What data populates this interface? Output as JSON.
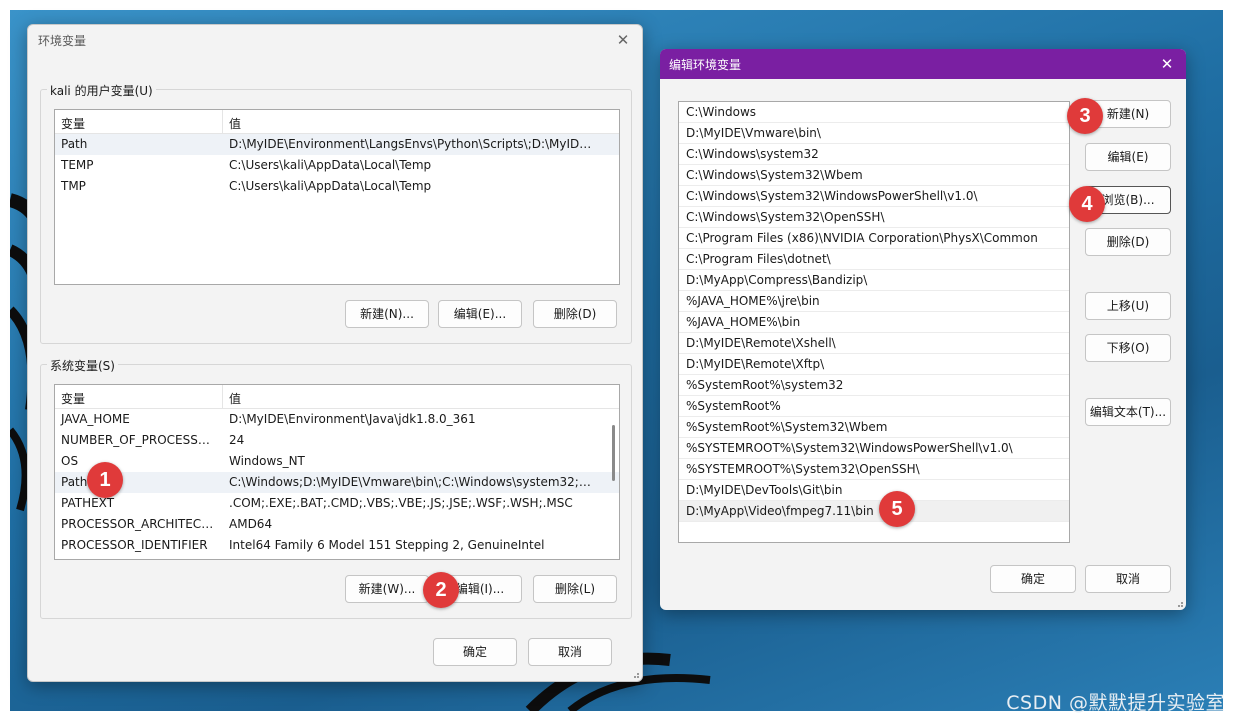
{
  "env_dialog": {
    "title": "环境变量",
    "user_group_title": "kali 的用户变量(U)",
    "user_columns": [
      "变量",
      "值"
    ],
    "user_rows": [
      {
        "name": "Path",
        "value": "D:\\MyIDE\\Environment\\LangsEnvs\\Python\\Scripts\\;D:\\MyIDE\\..."
      },
      {
        "name": "TEMP",
        "value": "C:\\Users\\kali\\AppData\\Local\\Temp"
      },
      {
        "name": "TMP",
        "value": "C:\\Users\\kali\\AppData\\Local\\Temp"
      }
    ],
    "user_buttons": {
      "new": "新建(N)...",
      "edit": "编辑(E)...",
      "delete": "删除(D)"
    },
    "system_group_title": "系统变量(S)",
    "system_columns": [
      "变量",
      "值"
    ],
    "system_rows": [
      {
        "name": "JAVA_HOME",
        "value": "D:\\MyIDE\\Environment\\Java\\jdk1.8.0_361"
      },
      {
        "name": "NUMBER_OF_PROCESSORS",
        "value": "24"
      },
      {
        "name": "OS",
        "value": "Windows_NT"
      },
      {
        "name": "Path",
        "value": "C:\\Windows;D:\\MyIDE\\Vmware\\bin\\;C:\\Windows\\system32;C:\\..."
      },
      {
        "name": "PATHEXT",
        "value": ".COM;.EXE;.BAT;.CMD;.VBS;.VBE;.JS;.JSE;.WSF;.WSH;.MSC"
      },
      {
        "name": "PROCESSOR_ARCHITECT...",
        "value": "AMD64"
      },
      {
        "name": "PROCESSOR_IDENTIFIER",
        "value": "Intel64 Family 6 Model 151 Stepping 2, GenuineIntel"
      }
    ],
    "system_buttons": {
      "new": "新建(W)...",
      "edit": "编辑(I)...",
      "delete": "删除(L)"
    },
    "ok": "确定",
    "cancel": "取消"
  },
  "edit_dialog": {
    "title": "编辑环境变量",
    "paths": [
      "C:\\Windows",
      "D:\\MyIDE\\Vmware\\bin\\",
      "C:\\Windows\\system32",
      "C:\\Windows\\System32\\Wbem",
      "C:\\Windows\\System32\\WindowsPowerShell\\v1.0\\",
      "C:\\Windows\\System32\\OpenSSH\\",
      "C:\\Program Files (x86)\\NVIDIA Corporation\\PhysX\\Common",
      "C:\\Program Files\\dotnet\\",
      "D:\\MyApp\\Compress\\Bandizip\\",
      "%JAVA_HOME%\\jre\\bin",
      "%JAVA_HOME%\\bin",
      "D:\\MyIDE\\Remote\\Xshell\\",
      "D:\\MyIDE\\Remote\\Xftp\\",
      "%SystemRoot%\\system32",
      "%SystemRoot%",
      "%SystemRoot%\\System32\\Wbem",
      "%SYSTEMROOT%\\System32\\WindowsPowerShell\\v1.0\\",
      "%SYSTEMROOT%\\System32\\OpenSSH\\",
      "D:\\MyIDE\\DevTools\\Git\\bin",
      "D:\\MyApp\\Video\\fmpeg7.11\\bin"
    ],
    "buttons": {
      "new": "新建(N)",
      "edit": "编辑(E)",
      "browse": "浏览(B)...",
      "delete": "删除(D)",
      "move_up": "上移(U)",
      "move_down": "下移(O)",
      "edit_text": "编辑文本(T)..."
    },
    "ok": "确定",
    "cancel": "取消"
  },
  "badges": [
    "1",
    "2",
    "3",
    "4",
    "5"
  ],
  "watermark": "CSDN @默默提升实验室",
  "colors": {
    "edit_titlebar": "#7a1fa2",
    "badge": "#e03a3a"
  }
}
